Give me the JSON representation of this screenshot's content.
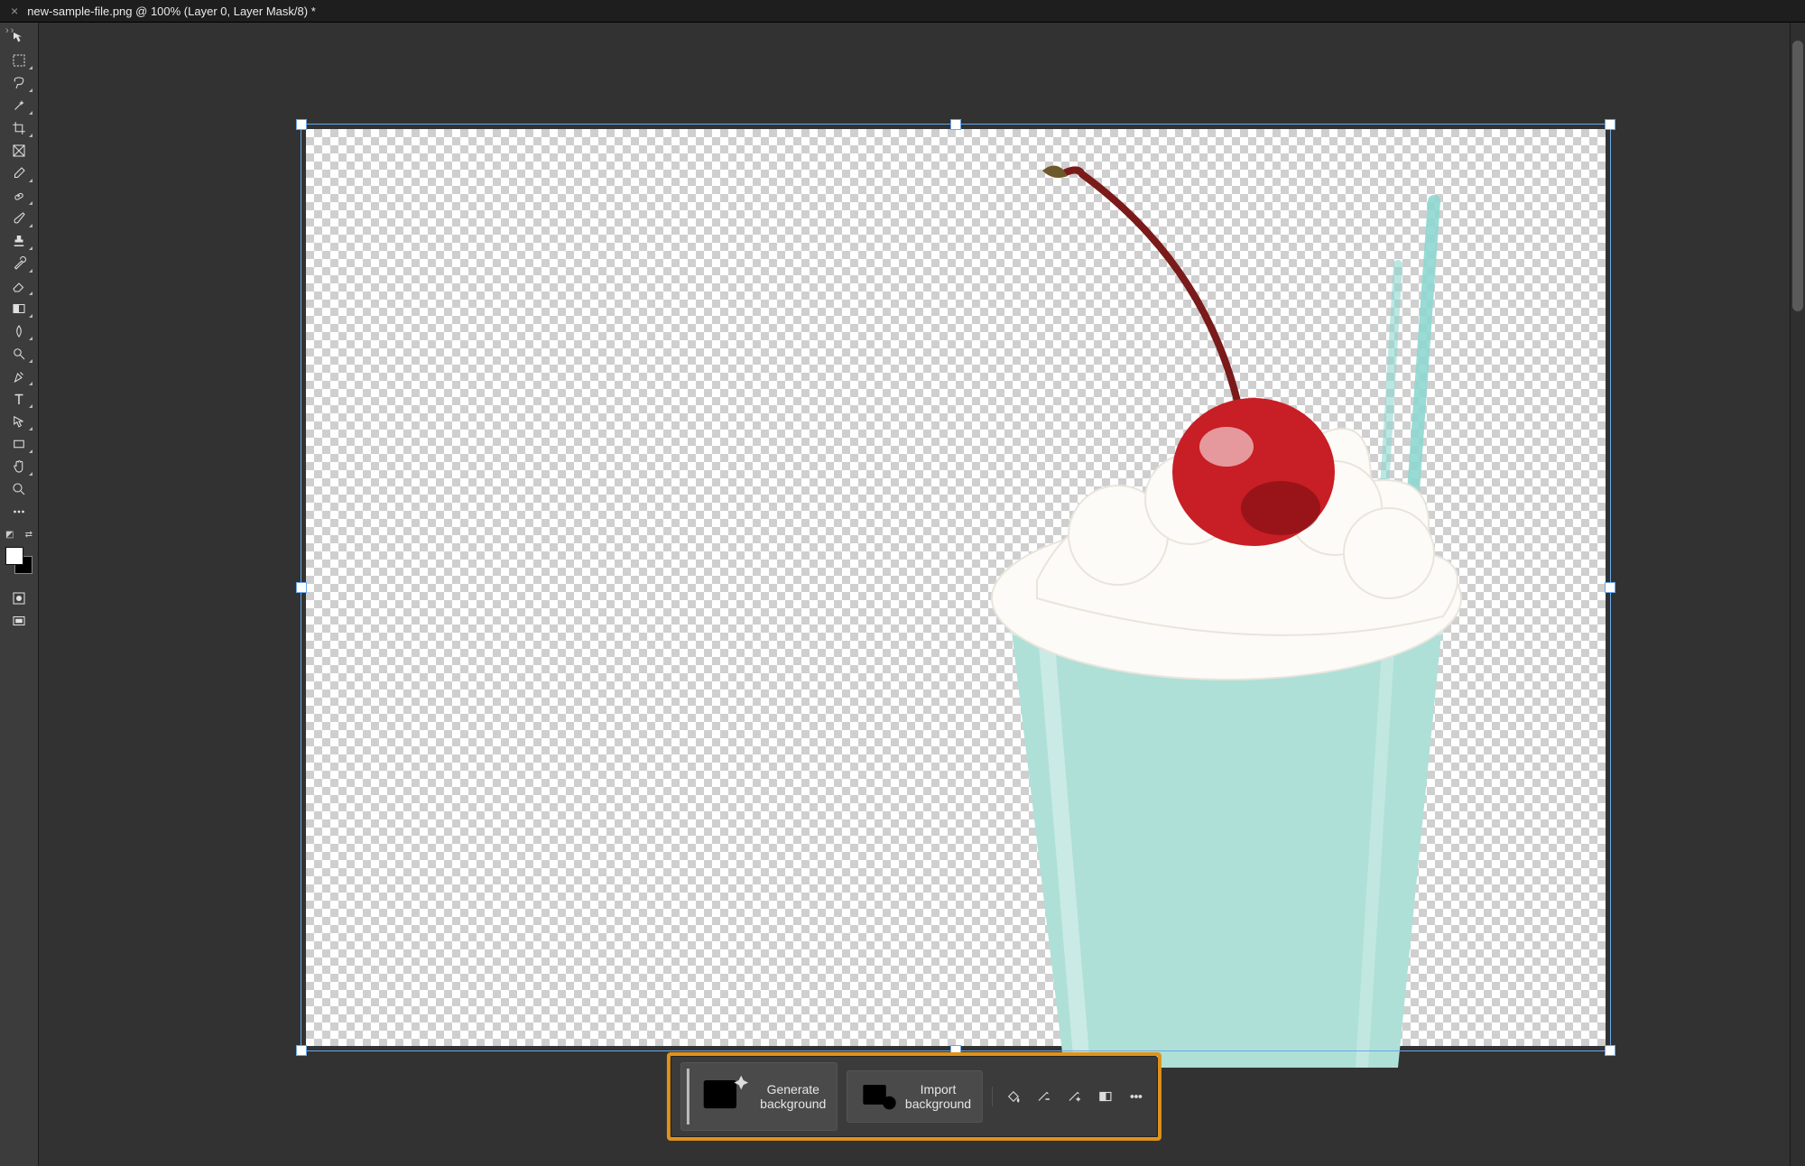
{
  "tab": {
    "close_glyph": "×",
    "title": "new-sample-file.png @ 100% (Layer 0, Layer Mask/8) *"
  },
  "tools": [
    {
      "id": "move",
      "name": "move-tool",
      "tri": false
    },
    {
      "id": "marquee",
      "name": "rectangular-marquee-tool",
      "tri": true
    },
    {
      "id": "lasso",
      "name": "lasso-tool",
      "tri": true
    },
    {
      "id": "wand",
      "name": "object-selection-tool",
      "tri": true
    },
    {
      "id": "crop",
      "name": "crop-tool",
      "tri": true
    },
    {
      "id": "frame",
      "name": "frame-tool",
      "tri": false
    },
    {
      "id": "eyedrop",
      "name": "eyedropper-tool",
      "tri": true
    },
    {
      "id": "heal",
      "name": "spot-healing-brush-tool",
      "tri": true
    },
    {
      "id": "brush",
      "name": "brush-tool",
      "tri": true
    },
    {
      "id": "stamp",
      "name": "clone-stamp-tool",
      "tri": true
    },
    {
      "id": "history",
      "name": "history-brush-tool",
      "tri": true
    },
    {
      "id": "eraser",
      "name": "eraser-tool",
      "tri": true
    },
    {
      "id": "gradient",
      "name": "gradient-tool",
      "tri": true
    },
    {
      "id": "blur",
      "name": "blur-tool",
      "tri": true
    },
    {
      "id": "dodge",
      "name": "dodge-tool",
      "tri": true
    },
    {
      "id": "pen",
      "name": "pen-tool",
      "tri": true
    },
    {
      "id": "type",
      "name": "type-tool",
      "tri": true
    },
    {
      "id": "path",
      "name": "path-selection-tool",
      "tri": true
    },
    {
      "id": "shape",
      "name": "rectangle-shape-tool",
      "tri": true
    },
    {
      "id": "hand",
      "name": "hand-tool",
      "tri": true
    },
    {
      "id": "zoom",
      "name": "zoom-tool",
      "tri": false
    },
    {
      "id": "more",
      "name": "edit-toolbar",
      "tri": false
    }
  ],
  "swatches": {
    "fg": "#ffffff",
    "bg": "#000000"
  },
  "extra_tools": [
    {
      "id": "quickmask",
      "name": "quick-mask-mode"
    },
    {
      "id": "screenmode",
      "name": "screen-mode"
    }
  ],
  "context_bar": {
    "generate_label": "Generate background",
    "import_label": "Import background",
    "icons": [
      {
        "id": "fill",
        "name": "remove-background-fill-icon"
      },
      {
        "id": "subtract",
        "name": "subtract-from-mask-icon"
      },
      {
        "id": "add",
        "name": "add-to-mask-icon"
      },
      {
        "id": "invert",
        "name": "invert-mask-icon"
      },
      {
        "id": "more",
        "name": "more-options-icon"
      }
    ]
  },
  "subject_alt": "milkshake with whipped cream and cherry on transparent background"
}
